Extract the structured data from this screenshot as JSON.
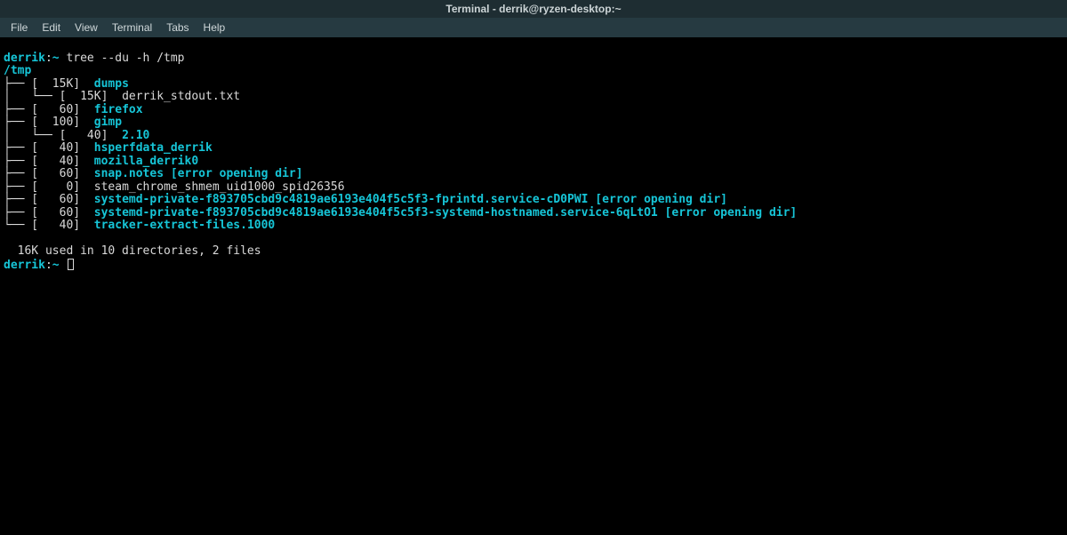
{
  "window": {
    "title": "Terminal - derrik@ryzen-desktop:~"
  },
  "menubar": {
    "items": [
      "File",
      "Edit",
      "View",
      "Terminal",
      "Tabs",
      "Help"
    ]
  },
  "colors": {
    "prompt_user": "#16c5d7",
    "titlebar_bg": "#1e2d32",
    "menubar_bg": "#263a41",
    "term_bg": "#000000",
    "term_fg": "#d9d9d9"
  },
  "prompt": {
    "user": "derrik",
    "sep": ":",
    "path": "~",
    "command": "tree --du -h /tmp"
  },
  "tree": {
    "root": "/tmp",
    "lines": [
      {
        "prefix": "├── [",
        "size": "  15K",
        "post": "]  ",
        "name": "dumps"
      },
      {
        "prefix": "│   └── [",
        "size": "  15K",
        "post": "]  ",
        "name": "derrik_stdout.txt"
      },
      {
        "prefix": "├── [",
        "size": "   60",
        "post": "]  ",
        "name": "firefox"
      },
      {
        "prefix": "├── [",
        "size": "  100",
        "post": "]  ",
        "name": "gimp"
      },
      {
        "prefix": "│   └── [",
        "size": "   40",
        "post": "]  ",
        "name": "2.10"
      },
      {
        "prefix": "├── [",
        "size": "   40",
        "post": "]  ",
        "name": "hsperfdata_derrik"
      },
      {
        "prefix": "├── [",
        "size": "   40",
        "post": "]  ",
        "name": "mozilla_derrik0"
      },
      {
        "prefix": "├── [",
        "size": "   60",
        "post": "]  ",
        "name": "snap.notes [error opening dir]"
      },
      {
        "prefix": "├── [",
        "size": "    0",
        "post": "]  ",
        "name": "steam_chrome_shmem_uid1000_spid26356"
      },
      {
        "prefix": "├── [",
        "size": "   60",
        "post": "]  ",
        "name": "systemd-private-f893705cbd9c4819ae6193e404f5c5f3-fprintd.service-cD0PWI [error opening dir]"
      },
      {
        "prefix": "├── [",
        "size": "   60",
        "post": "]  ",
        "name": "systemd-private-f893705cbd9c4819ae6193e404f5c5f3-systemd-hostnamed.service-6qLtO1 [error opening dir]"
      },
      {
        "prefix": "└── [",
        "size": "   40",
        "post": "]  ",
        "name": "tracker-extract-files.1000"
      }
    ],
    "summary": "  16K used in 10 directories, 2 files"
  },
  "prompt2": {
    "user": "derrik",
    "sep": ":",
    "path": "~"
  }
}
